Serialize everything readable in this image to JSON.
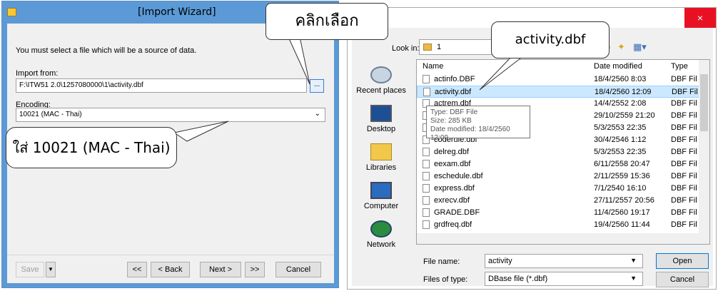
{
  "wizard": {
    "title": "[Import Wizard]",
    "hint": "You must select a file which will be a source of data.",
    "import_label": "Import from:",
    "import_path": "F:\\ITW51 2.0\\1257080000\\1\\activity.dbf",
    "browse_label": "...",
    "encoding_label": "Encoding:",
    "encoding_value": "10021 (MAC - Thai)",
    "buttons": {
      "save": "Save",
      "first": "<<",
      "back": "< Back",
      "next": "Next >",
      "last": ">>",
      "cancel": "Cancel"
    }
  },
  "dialog": {
    "close": "×",
    "look_in_label": "Look in:",
    "look_in_value": "1",
    "places": [
      "Recent places",
      "Desktop",
      "Libraries",
      "Computer",
      "Network"
    ],
    "columns": {
      "name": "Name",
      "date": "Date modified",
      "type": "Type"
    },
    "files": [
      {
        "name": "actinfo.DBF",
        "date": "18/4/2560 8:03",
        "type": "DBF Fil"
      },
      {
        "name": "activity.dbf",
        "date": "18/4/2560 12:09",
        "type": "DBF Fil",
        "selected": true
      },
      {
        "name": "actrem.dbf",
        "date": "14/4/2552 2:08",
        "type": "DBF Fil"
      },
      {
        "name": "bullatin.db",
        "date": "29/10/2559 21:20",
        "type": "DBF Fil"
      },
      {
        "name": "chgreg.db",
        "date": "5/3/2553 22:35",
        "type": "DBF Fil"
      },
      {
        "name": "coderule.dbf",
        "date": "30/4/2546 1:12",
        "type": "DBF Fil"
      },
      {
        "name": "delreg.dbf",
        "date": "5/3/2553 22:35",
        "type": "DBF Fil"
      },
      {
        "name": "eexam.dbf",
        "date": "6/11/2558 20:47",
        "type": "DBF Fil"
      },
      {
        "name": "eschedule.dbf",
        "date": "2/11/2559 15:36",
        "type": "DBF Fil"
      },
      {
        "name": "express.dbf",
        "date": "7/1/2540 16:10",
        "type": "DBF Fil"
      },
      {
        "name": "exrecv.dbf",
        "date": "27/11/2557 20:56",
        "type": "DBF Fil"
      },
      {
        "name": "GRADE.DBF",
        "date": "11/4/2560 19:17",
        "type": "DBF Fil"
      },
      {
        "name": "grdfreq.dbf",
        "date": "19/4/2560 11:44",
        "type": "DBF Fil"
      }
    ],
    "tooltip": {
      "type": "Type: DBF File",
      "size": "Size: 285 KB",
      "modified": "Date modified: 18/4/2560 12:09"
    },
    "file_name_label": "File name:",
    "file_name_value": "activity",
    "file_type_label": "Files of type:",
    "file_type_value": "DBase file (*.dbf)",
    "open": "Open",
    "cancel": "Cancel"
  },
  "callouts": {
    "click_select": "คลิกเลือก",
    "encoding_note": "ใส่ 10021 (MAC - Thai)",
    "file_note": "activity.dbf"
  }
}
